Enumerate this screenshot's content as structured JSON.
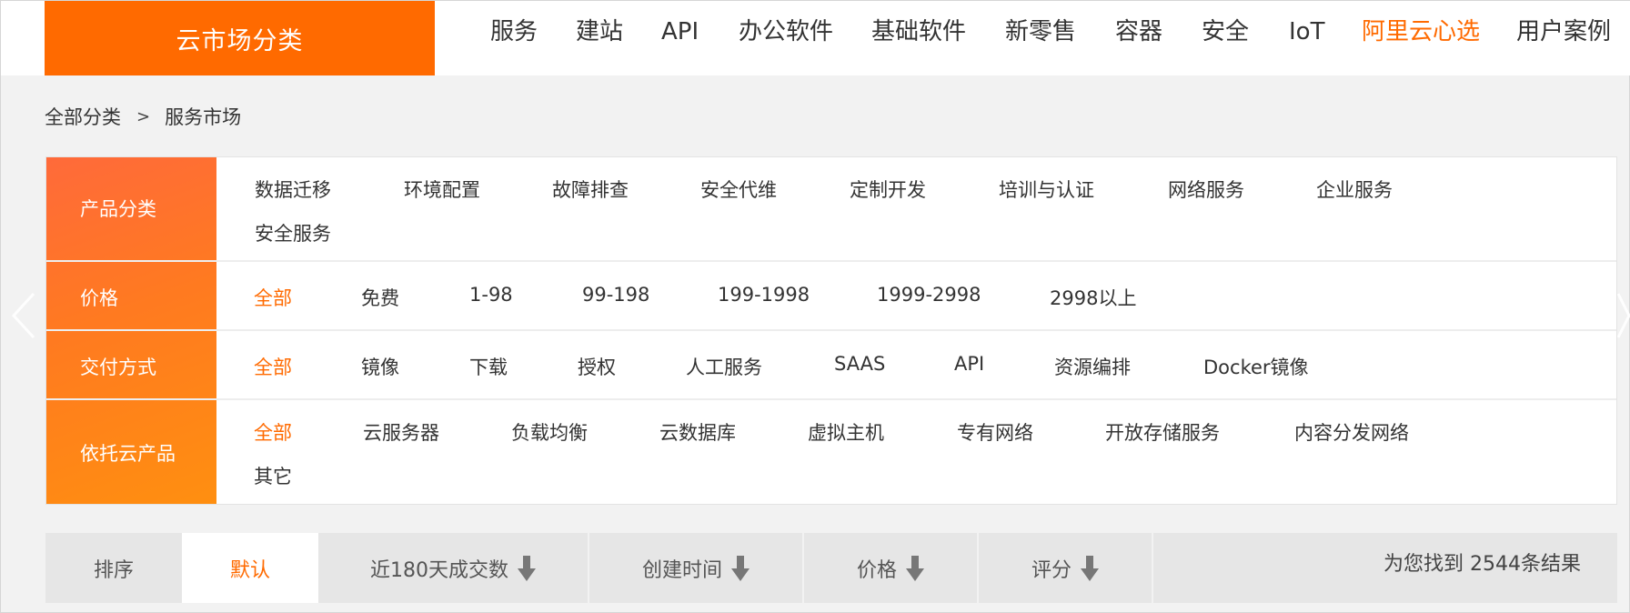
{
  "top_nav": {
    "category_button": "云市场分类",
    "items": [
      "服务",
      "建站",
      "API",
      "办公软件",
      "基础软件",
      "新零售",
      "容器",
      "安全",
      "IoT",
      "阿里云心选",
      "用户案例"
    ]
  },
  "breadcrumb": {
    "root": "全部分类",
    "separator": ">",
    "current": "服务市场"
  },
  "filters": {
    "category": {
      "label": "产品分类",
      "options": [
        "数据迁移",
        "环境配置",
        "故障排查",
        "安全代维",
        "定制开发",
        "培训与认证",
        "网络服务",
        "企业服务",
        "安全服务"
      ]
    },
    "price": {
      "label": "价格",
      "options": [
        "全部",
        "免费",
        "1-98",
        "99-198",
        "199-1998",
        "1999-2998",
        "2998以上"
      ]
    },
    "delivery": {
      "label": "交付方式",
      "options": [
        "全部",
        "镜像",
        "下载",
        "授权",
        "人工服务",
        "SAAS",
        "API",
        "资源编排",
        "Docker镜像"
      ]
    },
    "cloud_product": {
      "label": "依托云产品",
      "options": [
        "全部",
        "云服务器",
        "负载均衡",
        "云数据库",
        "虚拟主机",
        "专有网络",
        "开放存储服务",
        "内容分发网络",
        "其它"
      ]
    }
  },
  "sort_bar": {
    "label": "排序",
    "options": [
      "默认",
      "近180天成交数",
      "创建时间",
      "价格",
      "评分"
    ],
    "result_text": "为您找到 2544条结果"
  },
  "icons": {
    "sort": "arrow-down-icon",
    "carousel_prev": "chevron-left-icon",
    "carousel_next": "chevron-right-icon"
  },
  "colors": {
    "accent": "#ff6a00",
    "label_gradient_start": "#ff6a3a",
    "label_gradient_end": "#ff8f10",
    "page_bg": "#f2f2f2"
  }
}
